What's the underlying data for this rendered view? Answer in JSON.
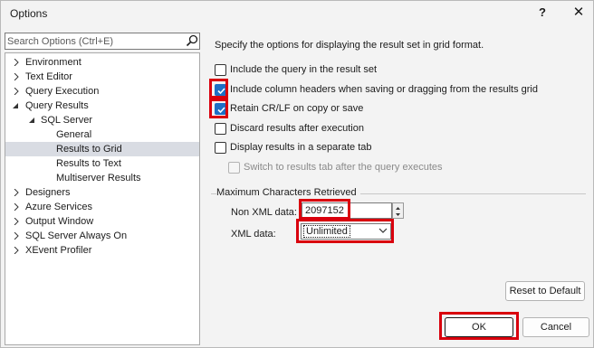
{
  "window": {
    "title": "Options",
    "help_label": "?",
    "close_label": "✕"
  },
  "search": {
    "placeholder": "Search Options (Ctrl+E)",
    "icon": "search-icon"
  },
  "tree": [
    {
      "label": "Environment",
      "level": 0,
      "expandable": true,
      "expanded": false
    },
    {
      "label": "Text Editor",
      "level": 0,
      "expandable": true,
      "expanded": false
    },
    {
      "label": "Query Execution",
      "level": 0,
      "expandable": true,
      "expanded": false
    },
    {
      "label": "Query Results",
      "level": 0,
      "expandable": true,
      "expanded": true
    },
    {
      "label": "SQL Server",
      "level": 1,
      "expandable": true,
      "expanded": true
    },
    {
      "label": "General",
      "level": 2,
      "expandable": false
    },
    {
      "label": "Results to Grid",
      "level": 2,
      "expandable": false,
      "selected": true
    },
    {
      "label": "Results to Text",
      "level": 2,
      "expandable": false
    },
    {
      "label": "Multiserver Results",
      "level": 2,
      "expandable": false
    },
    {
      "label": "Designers",
      "level": 0,
      "expandable": true,
      "expanded": false
    },
    {
      "label": "Azure Services",
      "level": 0,
      "expandable": true,
      "expanded": false
    },
    {
      "label": "Output Window",
      "level": 0,
      "expandable": true,
      "expanded": false
    },
    {
      "label": "SQL Server Always On",
      "level": 0,
      "expandable": true,
      "expanded": false
    },
    {
      "label": "XEvent Profiler",
      "level": 0,
      "expandable": true,
      "expanded": false
    }
  ],
  "description": "Specify the options for displaying the result set in grid format.",
  "options": [
    {
      "label": "Include the query in the result set",
      "checked": false,
      "disabled": false
    },
    {
      "label": "Include column headers when saving or dragging from the results grid",
      "checked": true,
      "disabled": false
    },
    {
      "label": "Retain CR/LF on copy or save",
      "checked": true,
      "disabled": false
    },
    {
      "label": "Discard results after execution",
      "checked": false,
      "disabled": false
    },
    {
      "label": "Display results in a separate tab",
      "checked": false,
      "disabled": false
    },
    {
      "label": "Switch to results tab after the query executes",
      "checked": false,
      "disabled": true
    }
  ],
  "max_chars": {
    "group_label": "Maximum Characters Retrieved",
    "non_xml_label": "Non XML data:",
    "non_xml_value": "2097152",
    "xml_label": "XML data:",
    "xml_value": "Unlimited"
  },
  "buttons": {
    "reset": "Reset to Default",
    "ok": "OK",
    "cancel": "Cancel"
  },
  "colors": {
    "highlight": "#d9000d",
    "checkbox_checked": "#1d6fc5",
    "selected_row": "#d9dce3"
  }
}
